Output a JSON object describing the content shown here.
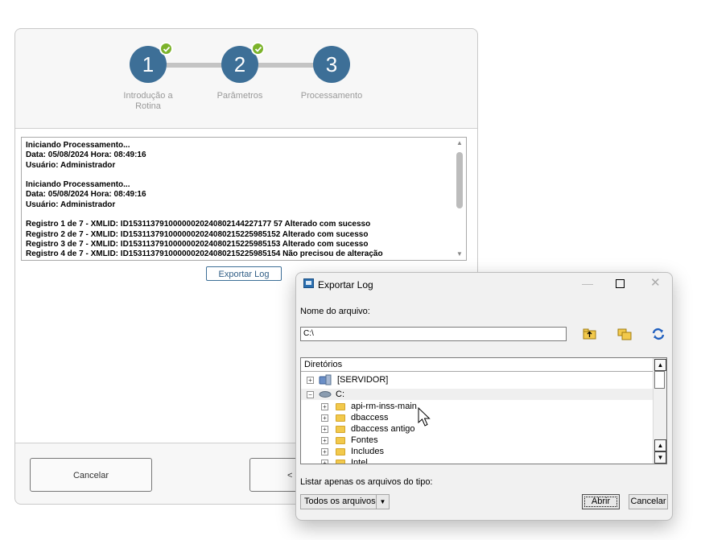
{
  "wizard": {
    "steps": [
      {
        "number": "1",
        "label": "Introdução a\nRotina",
        "completed": true
      },
      {
        "number": "2",
        "label": "Parâmetros",
        "completed": true
      },
      {
        "number": "3",
        "label": "Processamento",
        "completed": false
      }
    ],
    "log_lines": [
      "Iniciando Processamento...",
      "Data: 05/08/2024 Hora: 08:49:16",
      "Usuário: Administrador",
      "",
      "Iniciando Processamento...",
      "Data: 05/08/2024 Hora: 08:49:16",
      "Usuário: Administrador",
      "",
      "Registro 1 de 7 - XMLID: ID15311379100000020240802144227177 57 Alterado com sucesso",
      "Registro 2 de 7 - XMLID: ID1531137910000002024080215225985152 Alterado com sucesso",
      "Registro 3 de 7 - XMLID: ID1531137910000002024080215225985153 Alterado com sucesso",
      "Registro 4 de 7 - XMLID: ID1531137910000002024080215225985154 Não precisou de alteração"
    ],
    "export_button": "Exportar Log",
    "cancel_button": "Cancelar",
    "prev_button": "<"
  },
  "dialog": {
    "title": "Exportar Log",
    "file_name_label": "Nome do arquivo:",
    "file_name_value": "C:\\",
    "tree_header": "Diretórios",
    "tree_items": [
      {
        "label": "[SERVIDOR]",
        "level": 0,
        "icon": "server-icon",
        "expander": "+"
      },
      {
        "label": "C:",
        "level": 0,
        "icon": "drive-icon",
        "expander": "-"
      },
      {
        "label": "api-rm-inss-main",
        "level": 1,
        "icon": "folder-icon",
        "expander": "+"
      },
      {
        "label": "dbaccess",
        "level": 1,
        "icon": "folder-icon",
        "expander": "+"
      },
      {
        "label": "dbaccess antigo",
        "level": 1,
        "icon": "folder-icon",
        "expander": "+"
      },
      {
        "label": "Fontes",
        "level": 1,
        "icon": "folder-icon",
        "expander": "+"
      },
      {
        "label": "Includes",
        "level": 1,
        "icon": "folder-icon",
        "expander": "+"
      },
      {
        "label": "Intel",
        "level": 1,
        "icon": "folder-icon",
        "expander": "+"
      }
    ],
    "file_type_label": "Listar apenas os arquivos do tipo:",
    "file_type_value": "Todos os arquivos",
    "open_button": "Abrir",
    "cancel_button": "Cancelar",
    "colors": {
      "accent": "#3d6f97",
      "check": "#7cb32b"
    }
  }
}
